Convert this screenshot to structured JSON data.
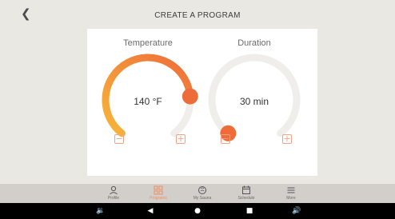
{
  "header": {
    "back_icon": "chevron-left-icon",
    "title": "CREATE A PROGRAM"
  },
  "temperature": {
    "label": "Temperature",
    "value": "140 °F",
    "level": 0.8,
    "minus_icon": "minus-icon",
    "plus_icon": "plus-icon"
  },
  "duration": {
    "label": "Duration",
    "value": "30 min",
    "level": 0.0,
    "minus_icon": "minus-icon",
    "plus_icon": "plus-icon"
  },
  "tabs": [
    {
      "label": "Profile",
      "icon": "person-icon"
    },
    {
      "label": "Programs",
      "icon": "grid-icon",
      "active": true
    },
    {
      "label": "My Sauna",
      "icon": "sauna-icon"
    },
    {
      "label": "Schedule",
      "icon": "calendar-icon"
    },
    {
      "label": "More",
      "icon": "menu-icon"
    }
  ],
  "system_nav": [
    "volume-down-icon",
    "back-triangle-icon",
    "home-circle-icon",
    "recents-square-icon",
    "volume-up-icon"
  ],
  "colors": {
    "accent": "#ee6c3a",
    "gradient_start": "#f7b63a",
    "track": "#efeeea",
    "tab_active": "#ee8d64"
  }
}
